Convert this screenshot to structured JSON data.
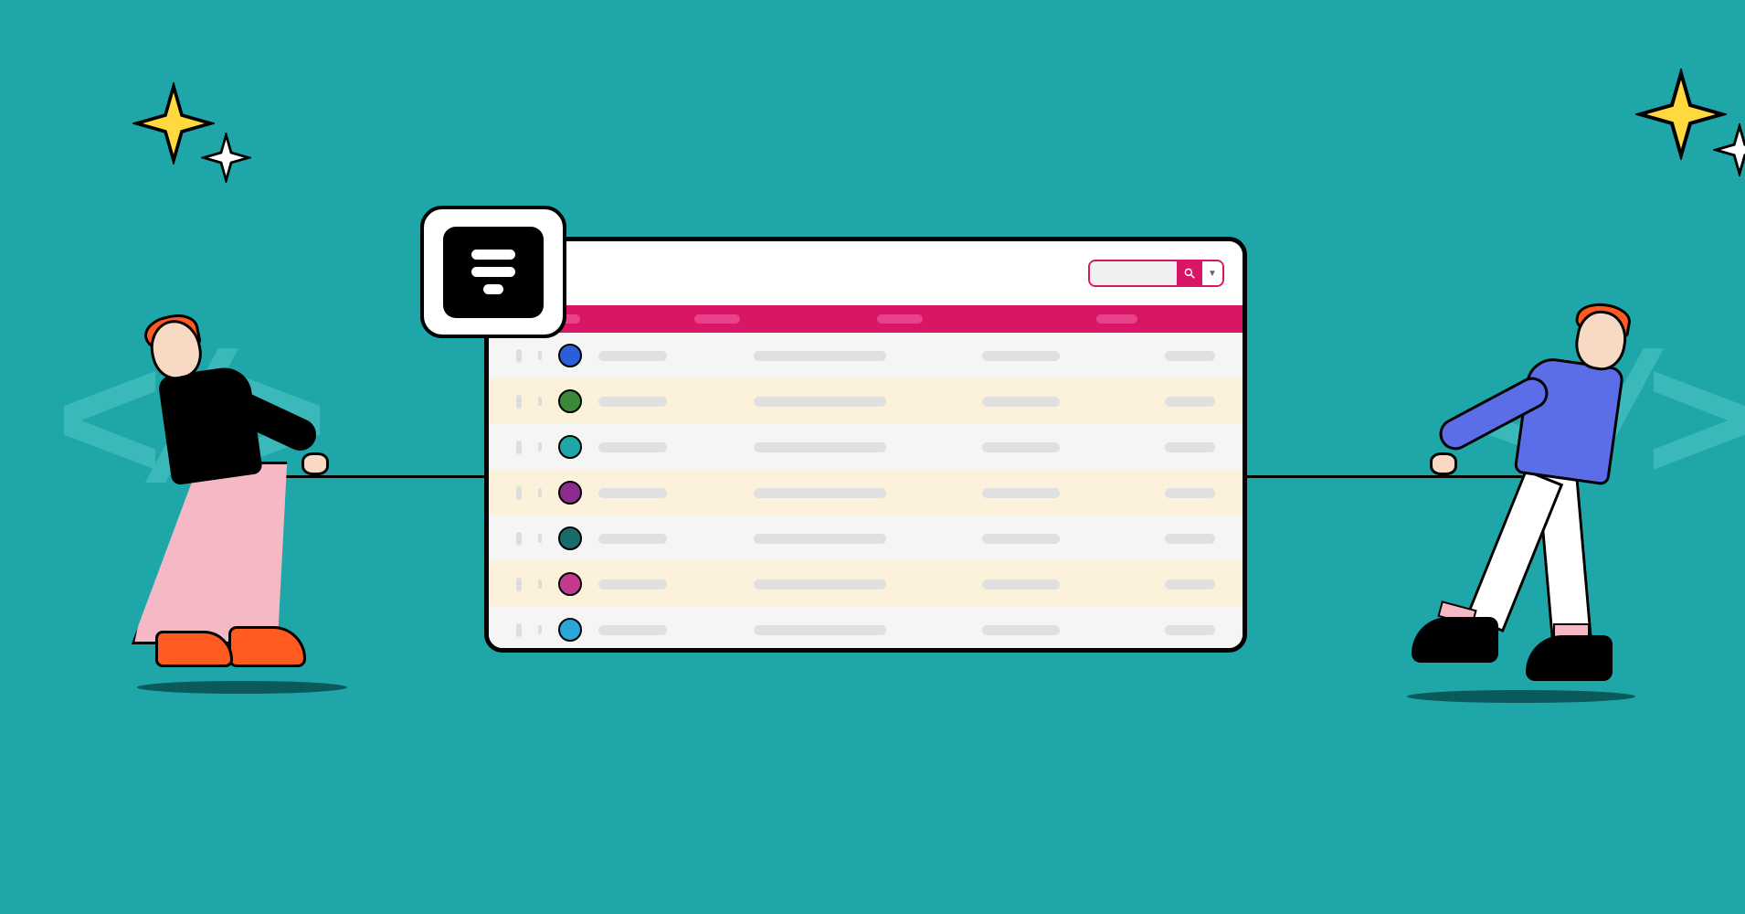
{
  "illustration": {
    "theme": "tug-of-war-over-data-table",
    "background_color": "#1FA6A8",
    "decorations": {
      "sparkle_colors": [
        "#FFD93D",
        "#FFFFFF"
      ],
      "code_brackets": "</>",
      "bracket_color": "#3AB8BA"
    },
    "browser_window": {
      "search": {
        "icon": "search-icon",
        "dropdown_icon": "chevron-down-icon"
      },
      "header_color": "#D91566",
      "rows": [
        {
          "variant": "odd",
          "avatar_color": "#2B5FD9"
        },
        {
          "variant": "even",
          "avatar_color": "#3A8A3A"
        },
        {
          "variant": "odd",
          "avatar_color": "#1FA6A8"
        },
        {
          "variant": "even",
          "avatar_color": "#8E2B8E"
        },
        {
          "variant": "odd",
          "avatar_color": "#1A6B6B"
        },
        {
          "variant": "even",
          "avatar_color": "#C43A8E"
        },
        {
          "variant": "odd",
          "avatar_color": "#2BA6D9"
        }
      ]
    },
    "logo": {
      "shape": "three-centered-lines",
      "bg": "#000",
      "fg": "#fff"
    },
    "people": {
      "left": {
        "hair_color": "#FF5A1F",
        "top_color": "#000",
        "skirt_color": "#F5B8C5",
        "shoe_color": "#FF5A1F"
      },
      "right": {
        "hair_color": "#FF5A1F",
        "jacket_color": "#5B6EE8",
        "pants_color": "#FFFFFF",
        "shoe_color": "#000",
        "sock_color": "#F5B8C5"
      }
    }
  }
}
